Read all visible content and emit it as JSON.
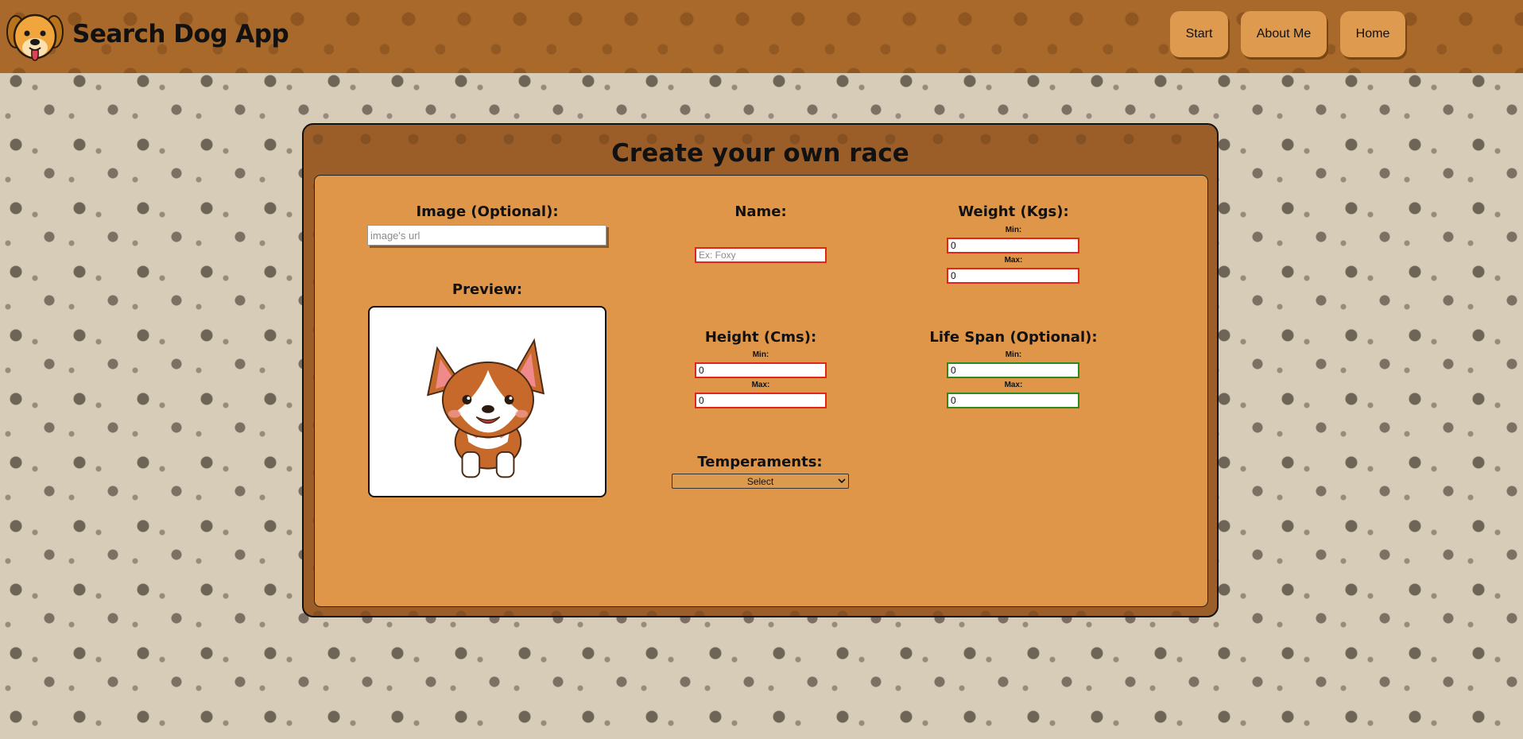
{
  "header": {
    "brand": "Search Dog App",
    "nav": {
      "start": "Start",
      "about": "About Me",
      "home": "Home"
    }
  },
  "form": {
    "title": "Create your own race",
    "image": {
      "label": "Image (Optional):",
      "placeholder": "image's url",
      "value": ""
    },
    "preview": {
      "label": "Preview:"
    },
    "name": {
      "label": "Name:",
      "placeholder": "Ex: Foxy",
      "value": ""
    },
    "weight": {
      "label": "Weight (Kgs):",
      "min_label": "Min:",
      "max_label": "Max:",
      "min": "0",
      "max": "0"
    },
    "height": {
      "label": "Height (Cms):",
      "min_label": "Min:",
      "max_label": "Max:",
      "min": "0",
      "max": "0"
    },
    "life_span": {
      "label": "Life Span (Optional):",
      "min_label": "Min:",
      "max_label": "Max:",
      "min": "0",
      "max": "0"
    },
    "temperaments": {
      "label": "Temperaments:",
      "selected": "Select"
    }
  },
  "icons": {
    "logo": "dog-face-logo",
    "preview_image": "corgi-illustration",
    "select_arrow": "chevron-down-icon"
  },
  "colors": {
    "header_bg": "#a8692a",
    "button_bg": "#de9a4e",
    "panel_bg": "#9b5e28",
    "form_bg": "#df9648",
    "invalid_border": "#e0261b",
    "valid_border": "#2a8a20"
  }
}
